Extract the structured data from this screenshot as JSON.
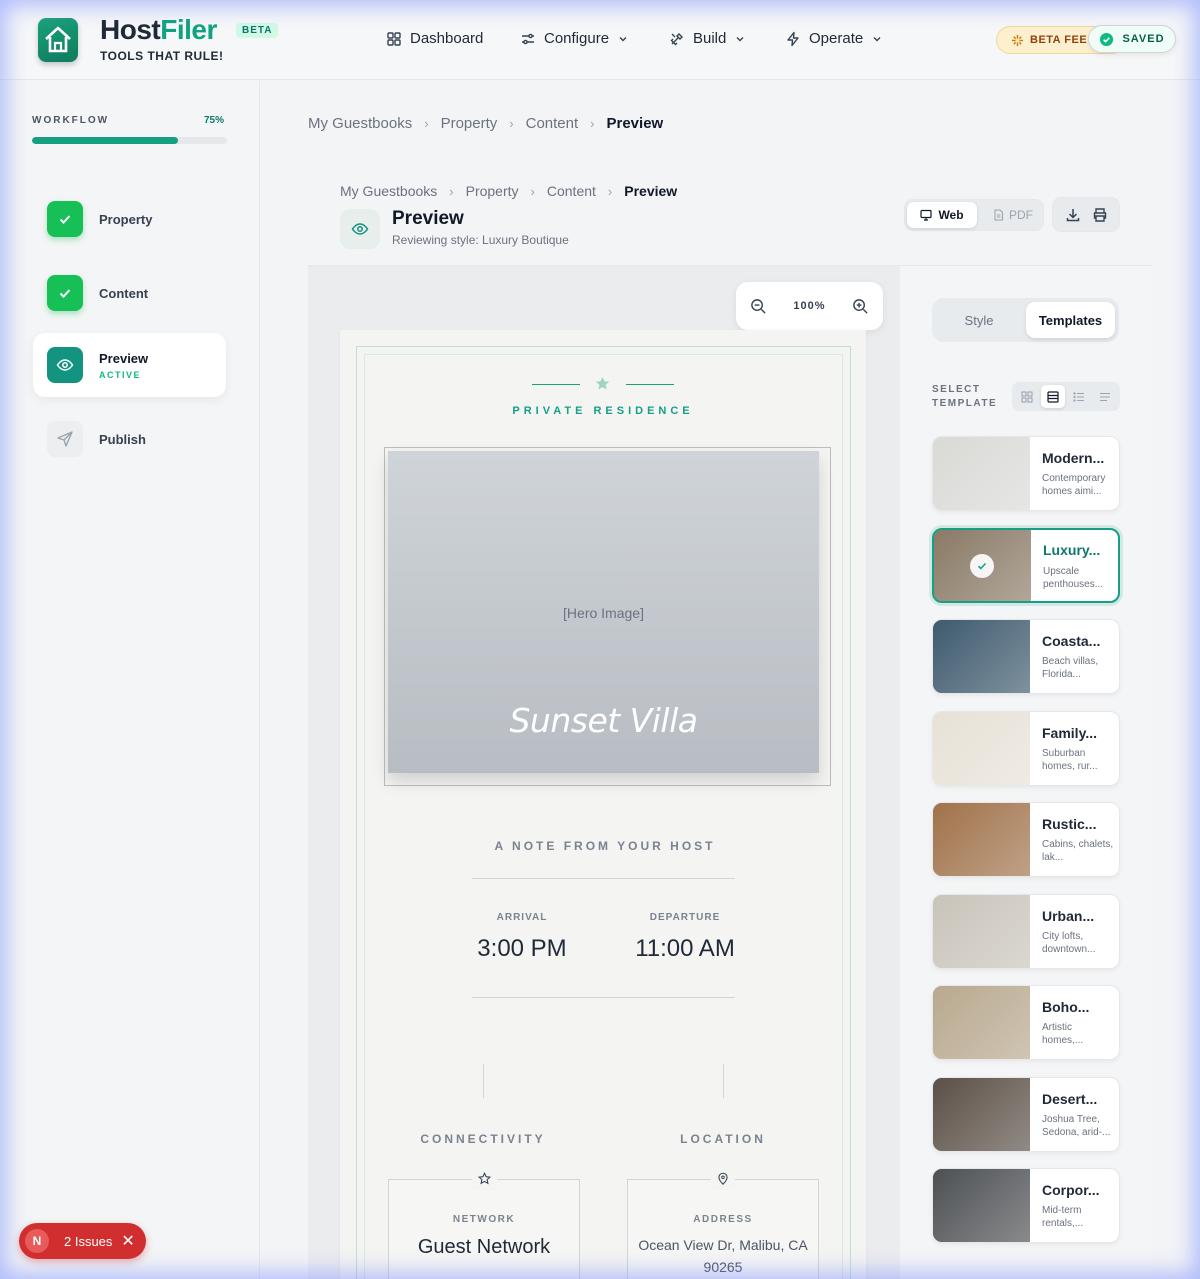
{
  "app": {
    "brand_main": "Host",
    "brand_accent": "Filer",
    "badge": "BETA",
    "tagline": "TOOLS THAT RULE!"
  },
  "nav": [
    {
      "label": "Dashboard",
      "icon": "grid-icon"
    },
    {
      "label": "Configure",
      "icon": "sliders-icon"
    },
    {
      "label": "Build",
      "icon": "tools-icon"
    },
    {
      "label": "Operate",
      "icon": "bolt-icon"
    }
  ],
  "header_status": {
    "beta_fee": "BETA FEE",
    "saved": "SAVED"
  },
  "workflow": {
    "label": "WORKFLOW",
    "percent_text": "75%",
    "progress": 0.75,
    "steps": [
      {
        "label": "Property",
        "state": "done"
      },
      {
        "label": "Content",
        "state": "done"
      },
      {
        "label": "Preview",
        "state": "active",
        "sub": "ACTIVE"
      },
      {
        "label": "Publish",
        "state": "todo"
      }
    ]
  },
  "breadcrumb": [
    "My Guestbooks",
    "Property",
    "Content",
    "Preview"
  ],
  "preview_panel": {
    "title": "Preview",
    "subtitle": "Reviewing style: Luxury Boutique",
    "web_label": "Web",
    "pdf_label": "PDF",
    "zoom_text": "100%"
  },
  "document": {
    "kicker": "PRIVATE RESIDENCE",
    "hero_placeholder": "[Hero Image]",
    "property_name": "Sunset Villa",
    "note_heading": "A NOTE FROM YOUR HOST",
    "arrival_label": "ARRIVAL",
    "arrival_time": "3:00 PM",
    "departure_label": "DEPARTURE",
    "departure_time": "11:00 AM",
    "connectivity_heading": "CONNECTIVITY",
    "location_heading": "LOCATION",
    "network_label": "NETWORK",
    "network_value": "Guest Network",
    "address_label": "ADDRESS",
    "address_value": "Ocean View Dr, Malibu, CA 90265"
  },
  "sidepanel": {
    "tab_style": "Style",
    "tab_templates": "Templates",
    "select_label": "SELECT TEMPLATE",
    "templates": [
      {
        "name": "Modern...",
        "desc": "Contemporary homes aimi...",
        "thumb": "#d9d9d6"
      },
      {
        "name": "Luxury...",
        "desc": "Upscale penthouses...",
        "thumb": "#8a7a66",
        "selected": true
      },
      {
        "name": "Coasta...",
        "desc": "Beach villas, Florida...",
        "thumb": "#3e5a6e"
      },
      {
        "name": "Family...",
        "desc": "Suburban homes, rur...",
        "thumb": "#e7e1d6"
      },
      {
        "name": "Rustic...",
        "desc": "Cabins, chalets, lak...",
        "thumb": "#a0724a"
      },
      {
        "name": "Urban...",
        "desc": "City lofts, downtown...",
        "thumb": "#c9c4ba"
      },
      {
        "name": "Boho...",
        "desc": "Artistic homes,...",
        "thumb": "#b8a88e"
      },
      {
        "name": "Desert...",
        "desc": "Joshua Tree, Sedona, arid-...",
        "thumb": "#5b5047"
      },
      {
        "name": "Corpor...",
        "desc": "Mid-term rentals,...",
        "thumb": "#4d5053"
      }
    ]
  },
  "issues": {
    "badge": "N",
    "label": "2 Issues"
  },
  "colors": {
    "brand": "#10a37f",
    "accent_dark": "#0f766e",
    "danger": "#d12f2f"
  }
}
